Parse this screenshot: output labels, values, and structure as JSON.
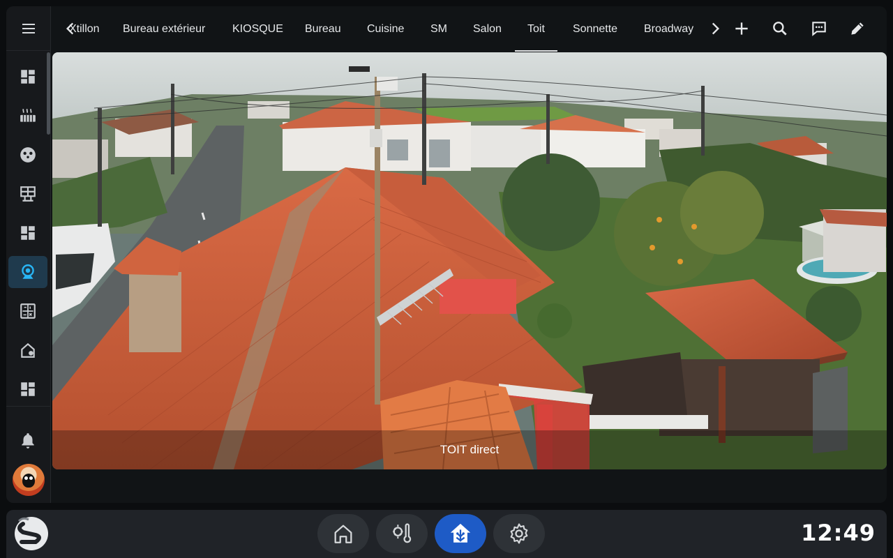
{
  "tabs": [
    {
      "label": "Xtillon",
      "active": false
    },
    {
      "label": "Bureau extérieur",
      "active": false
    },
    {
      "label": "KIOSQUE",
      "active": false
    },
    {
      "label": "Bureau",
      "active": false
    },
    {
      "label": "Cuisine",
      "active": false
    },
    {
      "label": "SM",
      "active": false
    },
    {
      "label": "Salon",
      "active": false
    },
    {
      "label": "Toit",
      "active": true
    },
    {
      "label": "Sonnette",
      "active": false
    },
    {
      "label": "Broadway",
      "active": false
    }
  ],
  "toolbar_icons": [
    "chevron-left-icon",
    "chevron-right-icon",
    "plus-icon",
    "search-icon",
    "assist-icon",
    "pencil-icon"
  ],
  "sidebar": {
    "items": [
      {
        "icon": "dashboard-icon",
        "active": false
      },
      {
        "icon": "radiator-icon",
        "active": false
      },
      {
        "icon": "robot-icon",
        "active": false
      },
      {
        "icon": "floorplan-icon",
        "active": false
      },
      {
        "icon": "dashboard-icon",
        "active": false
      },
      {
        "icon": "webcam-icon",
        "active": true
      },
      {
        "icon": "meter-icon",
        "active": false
      },
      {
        "icon": "home-outline-icon",
        "active": false
      },
      {
        "icon": "dashboard-icon",
        "active": false
      }
    ],
    "bottom_icons": [
      "bell-icon",
      "avatar"
    ],
    "accent": "#29b6f6"
  },
  "camera": {
    "caption": "TOIT direct"
  },
  "dock": {
    "logo": "s-logo-icon",
    "buttons": [
      {
        "icon": "home-icon",
        "active": false
      },
      {
        "icon": "thermometer-gear-icon",
        "active": false
      },
      {
        "icon": "home-assistant-icon",
        "active": true
      },
      {
        "icon": "settings-icon",
        "active": false
      }
    ],
    "active_color": "#1e5bc6",
    "clock": "12:49"
  }
}
